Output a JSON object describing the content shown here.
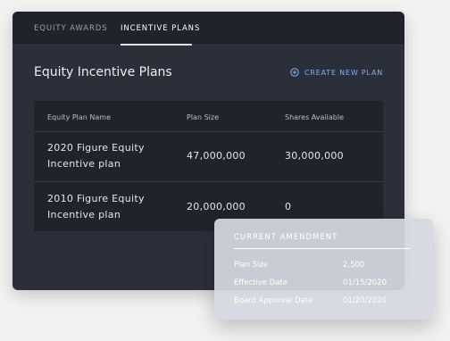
{
  "tabs": [
    {
      "label": "EQUITY AWARDS",
      "active": false
    },
    {
      "label": "INCENTIVE PLANS",
      "active": true
    }
  ],
  "page_title": "Equity Incentive Plans",
  "create_button": {
    "label": "CREATE NEW PLAN",
    "icon": "plus-circle-icon"
  },
  "table": {
    "headers": [
      "Equity Plan Name",
      "Plan Size",
      "Shares Available"
    ],
    "rows": [
      {
        "name": "2020 Figure Equity Incentive plan",
        "plan_size": "47,000,000",
        "shares_available": "30,000,000"
      },
      {
        "name": "2010 Figure Equity Incentive plan",
        "plan_size": "20,000,000",
        "shares_available": "0"
      }
    ]
  },
  "amendment": {
    "title": "CURRENT AMENDMENT",
    "fields": [
      {
        "label": "Plan Size",
        "value": "2,500"
      },
      {
        "label": "Effective Date",
        "value": "01/15/2020"
      },
      {
        "label": "Board Approval Date",
        "value": "01/20/2020"
      }
    ]
  },
  "colors": {
    "panel": "#2b2f3a",
    "tabbar": "#1f232c",
    "accent": "#7fb2f0",
    "overlay": "#d4d8e0"
  }
}
